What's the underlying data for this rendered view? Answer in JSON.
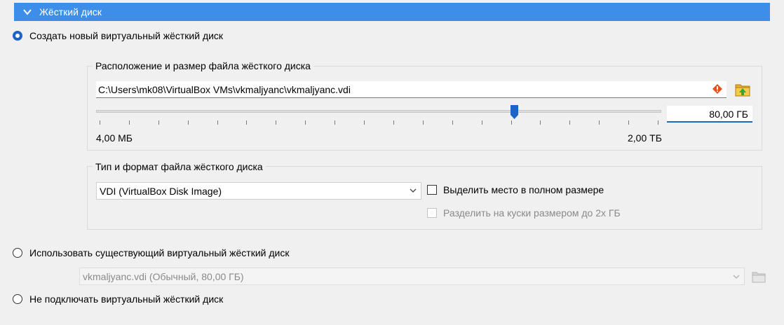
{
  "section": {
    "title": "Жёсткий диск",
    "icon": "chevron-down-icon"
  },
  "options": {
    "create_new": "Создать новый виртуальный жёсткий диск",
    "use_existing": "Использовать существующий виртуальный жёсткий диск",
    "no_disk": "Не подключать виртуальный жёсткий диск"
  },
  "location_group": {
    "title": "Расположение и размер файла жёсткого диска",
    "path": "C:\\Users\\mk08\\VirtualBox VMs\\vkmaljyanc\\vkmaljyanc.vdi",
    "size_value": "80,00 ГБ",
    "size_fraction": 0.74,
    "min_label": "4,00 МБ",
    "max_label": "2,00 ТБ",
    "warning_icon": "warning-icon",
    "folder_icon": "folder-icon"
  },
  "format_group": {
    "title": "Тип и формат файла жёсткого диска",
    "format_selected": "VDI (VirtualBox Disk Image)",
    "preallocate_label": "Выделить место в полном размере",
    "split_label": "Разделить на куски размером до 2х ГБ"
  },
  "existing": {
    "selected": "vkmaljyanc.vdi (Обычный, 80,00 ГБ)",
    "folder_icon": "folder-icon"
  },
  "colors": {
    "header_bg": "#3d8ee8",
    "accent": "#1e63c7"
  }
}
